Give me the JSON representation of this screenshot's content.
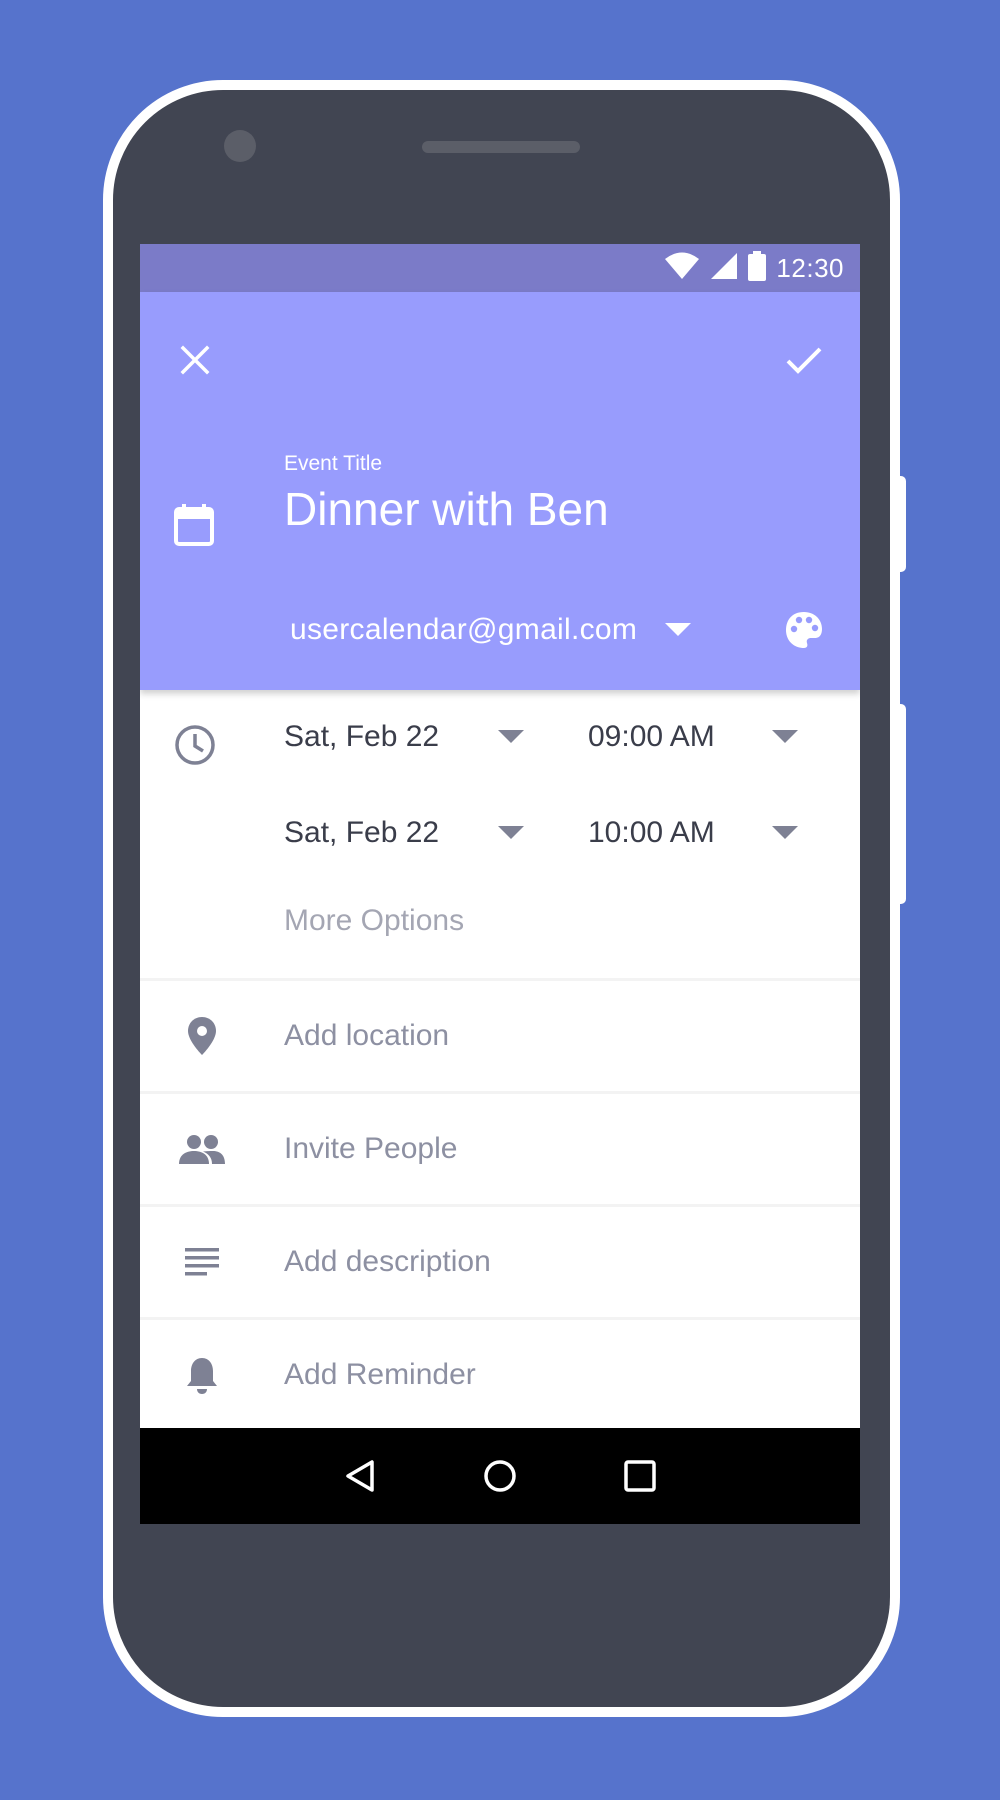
{
  "status_bar": {
    "time": "12:30",
    "icons": [
      "wifi-icon",
      "signal-icon",
      "battery-icon"
    ]
  },
  "header": {
    "close_icon": "close-icon",
    "save_icon": "check-icon",
    "event_label": "Event Title",
    "event_title": "Dinner with Ben",
    "calendar_icon": "calendar-icon",
    "account_email": "usercalendar@gmail.com",
    "palette_icon": "palette-icon"
  },
  "schedule": {
    "start": {
      "date": "Sat, Feb 22",
      "time": "09:00 AM"
    },
    "end": {
      "date": "Sat, Feb 22",
      "time": "10:00 AM"
    },
    "more_options": "More Options"
  },
  "rows": [
    {
      "icon": "location-pin-icon",
      "label": "Add location"
    },
    {
      "icon": "people-icon",
      "label": "Invite People"
    },
    {
      "icon": "description-icon",
      "label": "Add description"
    },
    {
      "icon": "bell-icon",
      "label": "Add Reminder"
    }
  ],
  "nav": [
    "back-icon",
    "home-icon",
    "recents-icon"
  ],
  "colors": {
    "background": "#5673CC",
    "header": "#989CFD",
    "status_bar": "#7B7BC8",
    "phone_body": "#414552",
    "icon_gray": "#7e8194"
  }
}
